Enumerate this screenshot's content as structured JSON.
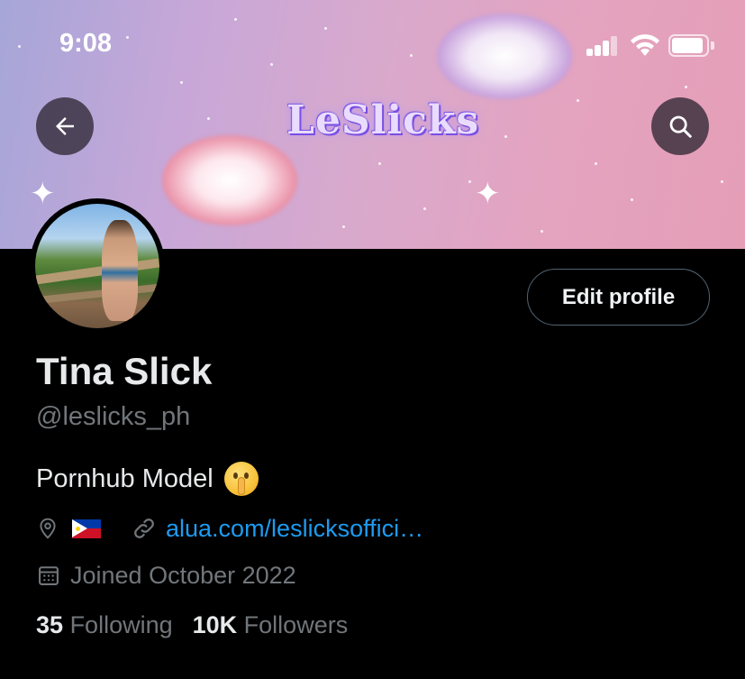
{
  "status_bar": {
    "time": "9:08"
  },
  "banner": {
    "logo_text": "LeSlicks"
  },
  "profile": {
    "name": "Tina Slick",
    "handle": "@leslicks_ph",
    "bio": "Pornhub Model",
    "edit_button": "Edit profile",
    "link": "alua.com/leslicksoffici…",
    "joined": "Joined October 2022",
    "following_count": "35",
    "following_label": "Following",
    "followers_count": "10K",
    "followers_label": "Followers"
  },
  "icons": {
    "back": "arrow-left-icon",
    "search": "search-icon",
    "location": "location-pin-icon",
    "link": "link-icon",
    "calendar": "calendar-icon"
  },
  "colors": {
    "background": "#000000",
    "text_primary": "#e7e9ea",
    "text_secondary": "#71767b",
    "link": "#1d9bf0"
  }
}
